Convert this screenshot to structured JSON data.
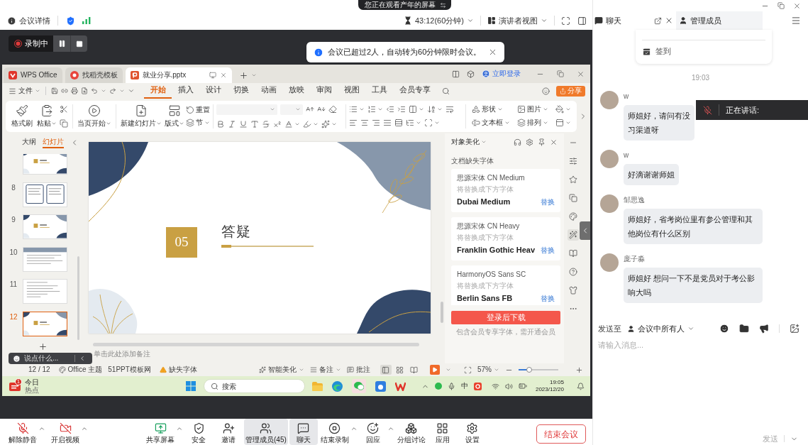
{
  "screen_banner": {
    "text": "您正在观看产年的屏幕"
  },
  "meeting_bar": {
    "details": "会议详情",
    "timer": "43:12(60分钟)",
    "view": "演讲者视图"
  },
  "recording": {
    "label": "录制中"
  },
  "notice": {
    "text": "会议已超过2人，自动转为60分钟限时会议。"
  },
  "wps": {
    "tabs": [
      {
        "kind": "home",
        "label": "WPS Office",
        "selected": false
      },
      {
        "kind": "template",
        "label": "找稻壳模板",
        "selected": false
      },
      {
        "kind": "document",
        "label": "就业分享.pptx",
        "selected": true
      }
    ],
    "login": "立即登录",
    "file_menu": "文件",
    "ribbon_tabs": [
      {
        "label": "开始",
        "selected": true
      },
      {
        "label": "插入",
        "selected": false
      },
      {
        "label": "设计",
        "selected": false
      },
      {
        "label": "切换",
        "selected": false
      },
      {
        "label": "动画",
        "selected": false
      },
      {
        "label": "放映",
        "selected": false
      },
      {
        "label": "审阅",
        "selected": false
      },
      {
        "label": "视图",
        "selected": false
      },
      {
        "label": "工具",
        "selected": false
      },
      {
        "label": "会员专享",
        "selected": false
      }
    ],
    "share": "分享",
    "ribbon": {
      "format_painter": "格式刷",
      "paste": "粘贴",
      "play_from_current": "当页开始",
      "new_slide": "新建幻灯片",
      "layout": "版式",
      "reset": "重置",
      "section": "节",
      "shapes": "形状",
      "picture": "图片",
      "text_box": "文本框",
      "arrange": "排列"
    },
    "panel_tabs": [
      {
        "label": "大纲",
        "selected": false
      },
      {
        "label": "幻灯片",
        "selected": true
      }
    ],
    "thumbnails": [
      {
        "kind": "section",
        "selected": false
      },
      {
        "number": "8",
        "kind": "columns",
        "selected": false
      },
      {
        "number": "9",
        "kind": "section",
        "selected": false
      },
      {
        "number": "10",
        "kind": "banner",
        "selected": false
      },
      {
        "number": "11",
        "kind": "text",
        "selected": false
      },
      {
        "number": "12",
        "kind": "section",
        "selected": true
      }
    ],
    "slide": {
      "number": "05",
      "title": "答疑"
    },
    "notes": {
      "placeholder": "单击此处添加备注"
    },
    "beautify": {
      "title": "对象美化",
      "section": "文档缺失字体",
      "fonts": [
        {
          "missing": "思源宋体 CN Medium",
          "hint": "将替换成下方字体",
          "replacement": "Dubai Medium",
          "action": "替换"
        },
        {
          "missing": "思源宋体 CN Heavy",
          "hint": "将替换成下方字体",
          "replacement": "Franklin Gothic Heav",
          "action": "替换"
        },
        {
          "missing": "HarmonyOS Sans SC",
          "hint": "将替换成下方字体",
          "replacement": "Berlin Sans FB",
          "action": "替换"
        }
      ],
      "download": "登录后下载",
      "footnote": "包含会员专享字体，需开通会员"
    },
    "side_tools": [
      {
        "kind": "collapse",
        "selected": false
      },
      {
        "kind": "properties",
        "selected": false
      },
      {
        "kind": "favorites",
        "selected": false
      },
      {
        "kind": "duplicate",
        "selected": false
      },
      {
        "kind": "style",
        "selected": false
      },
      {
        "kind": "beautify",
        "selected": true
      },
      {
        "kind": "reader",
        "selected": false
      },
      {
        "kind": "help",
        "selected": false
      },
      {
        "kind": "theme",
        "selected": false
      },
      {
        "kind": "more",
        "selected": false
      }
    ],
    "status_bar": {
      "slide_count": "12 / 12",
      "theme": "Office 主题",
      "source": "51PPT模板网",
      "missing_fonts": "缺失字体",
      "smart_beautify": "智能美化",
      "notes": "备注",
      "comments": "批注",
      "views": [
        {
          "kind": "normal",
          "selected": true
        },
        {
          "kind": "sorter",
          "selected": false
        },
        {
          "kind": "reading",
          "selected": false
        }
      ],
      "zoom": "57%",
      "zoom_slider": {
        "level": 0.27
      }
    }
  },
  "chat_overlay": {
    "placeholder": "说点什么..."
  },
  "taskbar": {
    "news": {
      "title": "今日",
      "subtitle": "热点",
      "badge": "1"
    },
    "search": {
      "placeholder": "搜索"
    },
    "ime": "中",
    "time": "19:05",
    "date": "2023/12/20"
  },
  "toolbar": {
    "audio_video": [
      {
        "kind": "mic_off",
        "label": "解除静音",
        "menu": true,
        "selected": false
      },
      {
        "kind": "video_off",
        "label": "开启视频",
        "menu": true,
        "selected": false
      }
    ],
    "actions": [
      {
        "kind": "share_screen",
        "label": "共享屏幕",
        "menu": true,
        "selected": false
      },
      {
        "kind": "security",
        "label": "安全",
        "menu": false,
        "selected": false
      },
      {
        "kind": "invite",
        "label": "邀请",
        "menu": false,
        "selected": false
      },
      {
        "kind": "members",
        "label": "管理成员(45)",
        "menu": false,
        "selected": true
      },
      {
        "kind": "chat",
        "label": "聊天",
        "menu": false,
        "selected": true
      },
      {
        "kind": "stop_recording",
        "label": "结束录制",
        "menu": true,
        "selected": false
      },
      {
        "kind": "reactions",
        "label": "回应",
        "menu": true,
        "selected": false
      },
      {
        "kind": "breakout",
        "label": "分组讨论",
        "menu": false,
        "selected": false
      },
      {
        "kind": "apps",
        "label": "应用",
        "menu": false,
        "selected": false
      },
      {
        "kind": "settings",
        "label": "设置",
        "menu": false,
        "selected": false
      }
    ],
    "end": "结束会议"
  },
  "chat": {
    "title": "聊天",
    "members_tab": "管理成员",
    "checkin": "签到",
    "time": "19:03",
    "messages": [
      {
        "name": "w",
        "lines": [
          "师姐好，请问有没",
          "习渠道呀"
        ]
      },
      {
        "name": "w",
        "lines": [
          "好滴谢谢师姐"
        ]
      },
      {
        "name": "邹思逸",
        "lines": [
          "师姐好，省考岗位里有参公管理和其他岗位有什么区别"
        ]
      },
      {
        "name": "庞子淼",
        "lines": [
          "师姐好 想问一下不是党员对于考公影响大吗"
        ]
      }
    ],
    "speaking": {
      "label": "正在讲话:"
    },
    "send_to": "发送至",
    "recipient": "会议中所有人",
    "input": {
      "placeholder": "请输入消息..."
    },
    "send": "发送"
  }
}
